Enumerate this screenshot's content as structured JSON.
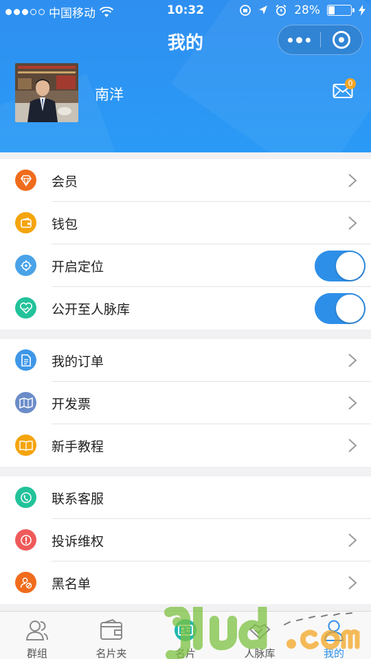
{
  "status_bar": {
    "carrier": "中国移动",
    "time": "10:32",
    "battery_text": "28%",
    "battery_level": 0.28
  },
  "header": {
    "title": "我的",
    "username": "南洋",
    "message_badge": "0",
    "background_color": "#2f8ff0"
  },
  "menu": {
    "groups": [
      {
        "items": [
          {
            "label": "会员",
            "icon": "diamond-icon",
            "icon_color": "#f06c1c",
            "control": "chevron"
          },
          {
            "label": "钱包",
            "icon": "wallet-icon",
            "icon_color": "#f5a40c",
            "control": "chevron"
          },
          {
            "label": "开启定位",
            "icon": "location-icon",
            "icon_color": "#4aa3e8",
            "control": "toggle",
            "toggle_on": true
          },
          {
            "label": "公开至人脉库",
            "icon": "handshake-heart-icon",
            "icon_color": "#22c29a",
            "control": "toggle",
            "toggle_on": true
          }
        ]
      },
      {
        "items": [
          {
            "label": "我的订单",
            "icon": "document-icon",
            "icon_color": "#3e97e8",
            "control": "chevron"
          },
          {
            "label": "开发票",
            "icon": "invoice-map-icon",
            "icon_color": "#6b8cc9",
            "control": "chevron"
          },
          {
            "label": "新手教程",
            "icon": "book-icon",
            "icon_color": "#f5a40c",
            "control": "chevron"
          }
        ]
      },
      {
        "items": [
          {
            "label": "联系客服",
            "icon": "phone-icon",
            "icon_color": "#22c29a",
            "control": "none"
          },
          {
            "label": "投诉维权",
            "icon": "alert-icon",
            "icon_color": "#ef5a5a",
            "control": "chevron"
          },
          {
            "label": "黑名单",
            "icon": "block-user-icon",
            "icon_color": "#f06c1c",
            "control": "chevron"
          }
        ]
      }
    ]
  },
  "tabbar": {
    "tabs": [
      {
        "label": "群组",
        "icon": "group-icon"
      },
      {
        "label": "名片夹",
        "icon": "card-holder-icon"
      },
      {
        "label": "名片",
        "icon": "card-icon"
      },
      {
        "label": "人脉库",
        "icon": "contacts-icon"
      },
      {
        "label": "我的",
        "icon": "user-icon",
        "active": true
      }
    ]
  },
  "accent_color": "#2e8fe8"
}
